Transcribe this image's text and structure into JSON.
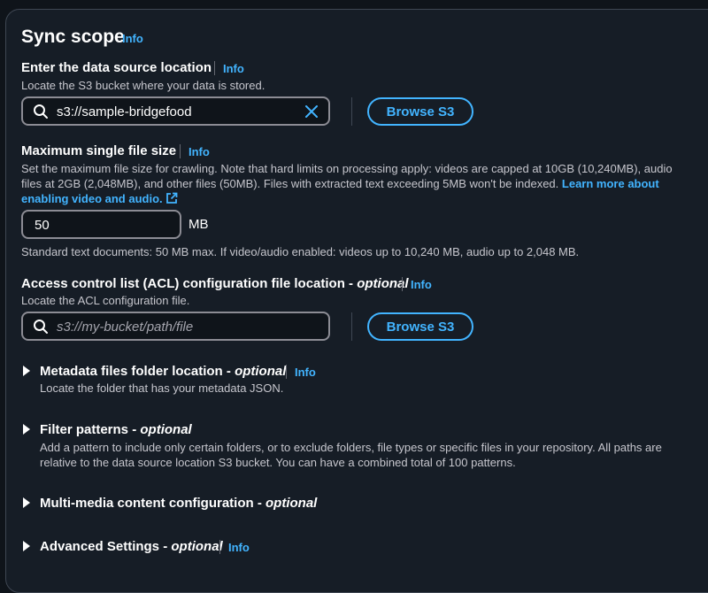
{
  "sync_scope": {
    "title": "Sync scope",
    "info": "Info"
  },
  "data_source": {
    "label": "Enter the data source location",
    "info": "Info",
    "description": "Locate the S3 bucket where your data is stored.",
    "value": "s3://sample-bridgefood",
    "browse_label": "Browse S3",
    "icons": {
      "search": "search-icon",
      "clear": "close-icon"
    }
  },
  "max_file_size": {
    "label": "Maximum single file size",
    "info": "Info",
    "description": "Set the maximum file size for crawling. Note that hard limits on processing apply: videos are capped at 10GB (10,240MB), audio files at 2GB (2,048MB), and other files (50MB). Files with extracted text exceeding 5MB won't be indexed.",
    "link_text": "Learn more about enabling video and audio.",
    "value": "50",
    "unit": "MB",
    "hint": "Standard text documents: 50 MB max. If video/audio enabled: videos up to 10,240 MB, audio up to 2,048 MB.",
    "icons": {
      "external": "external-link-icon"
    }
  },
  "acl": {
    "label": "Access control list (ACL) configuration file location",
    "optional": "optional",
    "info": "Info",
    "description": "Locate the ACL configuration file.",
    "placeholder": "s3://my-bucket/path/file",
    "browse_label": "Browse S3"
  },
  "sections": {
    "metadata": {
      "label": "Metadata files folder location",
      "optional": "optional",
      "info": "Info",
      "description": "Locate the folder that has your metadata JSON."
    },
    "filter": {
      "label": "Filter patterns",
      "optional": "optional",
      "description": "Add a pattern to include only certain folders, or to exclude folders, file types or specific files in your repository. All paths are relative to the data source location S3 bucket. You can have a combined total of 100 patterns."
    },
    "multimedia": {
      "label": "Multi-media content configuration",
      "optional": "optional"
    },
    "advanced": {
      "label": "Advanced Settings",
      "optional": "optional",
      "info": "Info"
    }
  },
  "colors": {
    "background": "#0f141a",
    "panel": "#161d26",
    "accent": "#42b4ff",
    "text": "#ffffff",
    "muted": "#c6c6cd"
  }
}
